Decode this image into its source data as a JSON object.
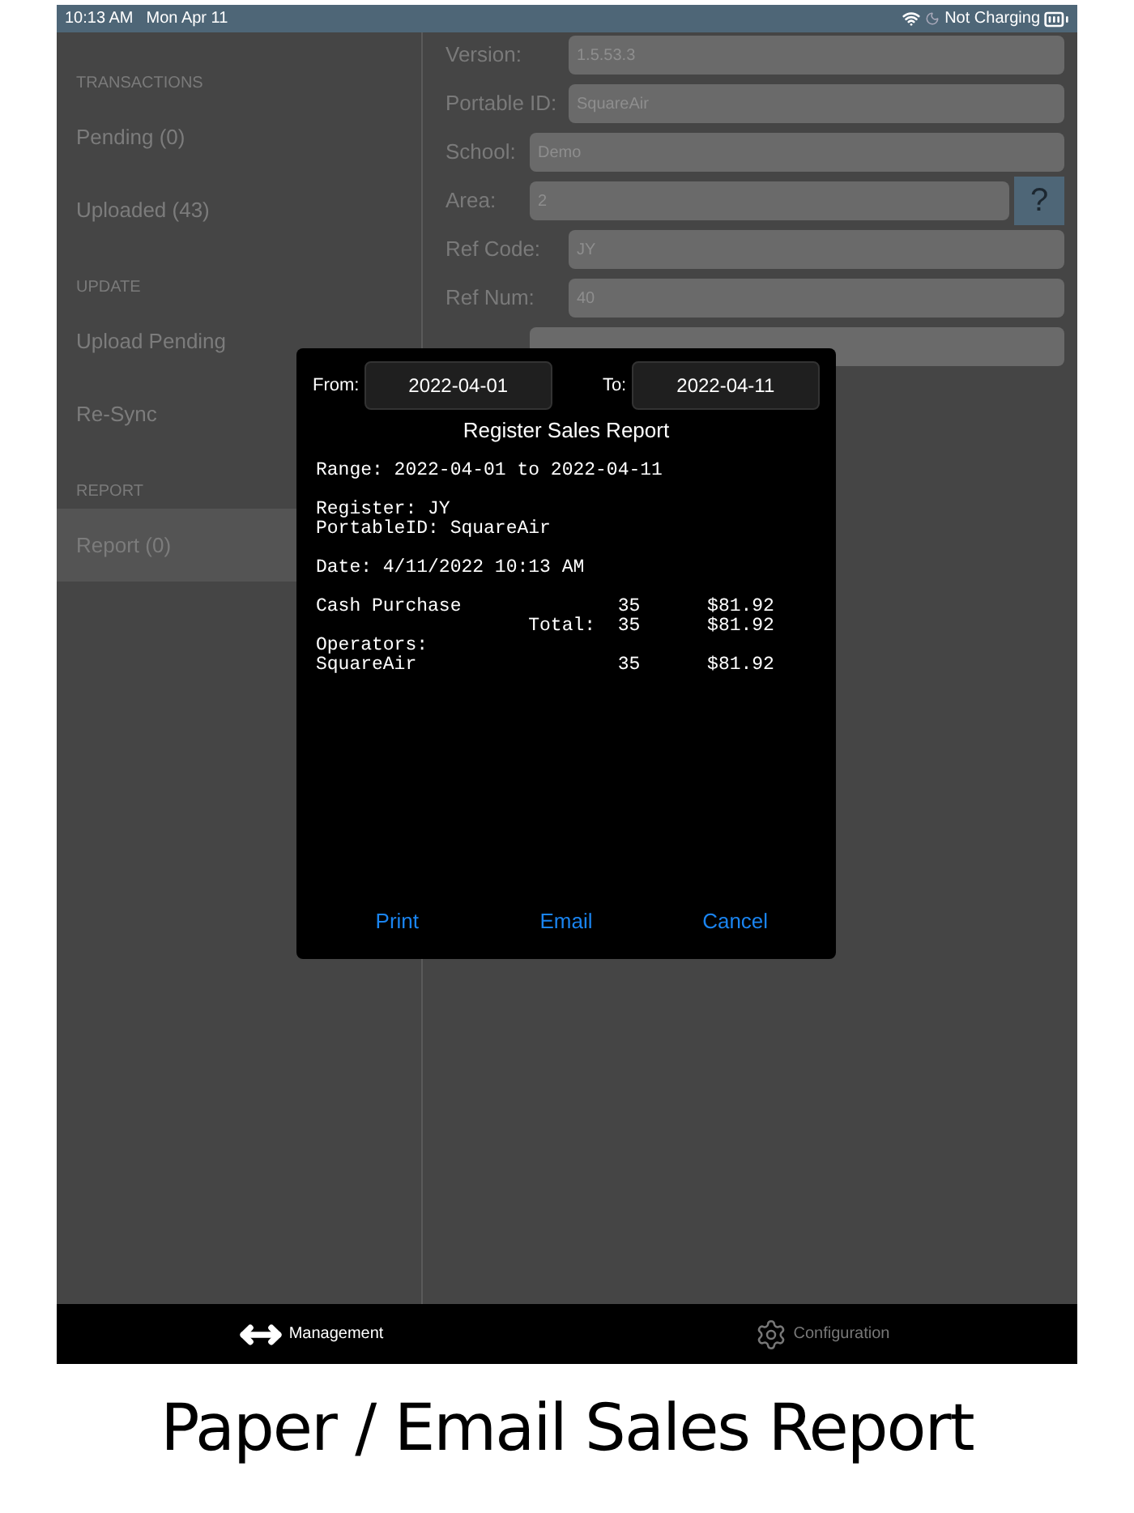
{
  "status_bar": {
    "time": "10:13 AM",
    "date": "Mon Apr 11",
    "battery_text": "Not Charging"
  },
  "sidebar": {
    "sections": [
      {
        "header": "TRANSACTIONS",
        "items": [
          {
            "label": "Pending (0)",
            "selected": false
          },
          {
            "label": "Uploaded (43)",
            "selected": false
          }
        ]
      },
      {
        "header": "UPDATE",
        "items": [
          {
            "label": "Upload Pending",
            "selected": false
          },
          {
            "label": "Re-Sync",
            "selected": false
          }
        ]
      },
      {
        "header": "REPORT",
        "items": [
          {
            "label": "Report (0)",
            "selected": true
          }
        ]
      }
    ]
  },
  "settings_form": [
    {
      "label": "Version:",
      "value": "1.5.53.3",
      "kind": "wide"
    },
    {
      "label": "Portable ID:",
      "value": "SquareAir",
      "kind": "wide"
    },
    {
      "label": "School:",
      "value": "Demo",
      "kind": "narrow"
    },
    {
      "label": "Area:",
      "value": "2",
      "kind": "help",
      "help": "?"
    },
    {
      "label": "Ref Code:",
      "value": "JY",
      "kind": "wide"
    },
    {
      "label": "Ref Num:",
      "value": "40",
      "kind": "wide"
    },
    {
      "kind": "narrow"
    }
  ],
  "report_dialog": {
    "from_label": "From:",
    "from_date": "2022-04-01",
    "to_label": "To:",
    "to_date": "2022-04-11",
    "title": "Register Sales Report",
    "report_blocks": [
      [
        "Range: 2022-04-01 to 2022-04-11"
      ],
      [
        "Register: JY",
        "PortableID: SquareAir"
      ],
      [
        "Date: 4/11/2022 10:13 AM"
      ],
      [
        "Cash Purchase              35      $81.92",
        "                   Total:  35      $81.92",
        "Operators:",
        "SquareAir                  35      $81.92"
      ]
    ],
    "buttons": [
      "Print",
      "Email",
      "Cancel"
    ]
  },
  "tab_bar": [
    {
      "label": "Management",
      "kind": "arrows",
      "selected": true
    },
    {
      "label": "Configuration",
      "kind": "gear",
      "selected": false
    }
  ],
  "caption": "Paper / Email Sales Report"
}
